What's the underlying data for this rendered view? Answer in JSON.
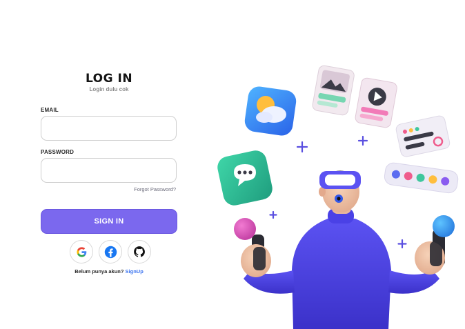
{
  "login": {
    "title": "LOG IN",
    "subtitle": "Login dulu cok",
    "email_label": "EMAIL",
    "email_value": "",
    "password_label": "PASSWORD",
    "password_value": "",
    "forgot_password": "Forgot Password?",
    "sign_in_button": "SIGN IN",
    "signup_prompt": "Belum punya akun?",
    "signup_link": "SignUp"
  },
  "social_buttons": [
    {
      "name": "Google",
      "icon": "google-icon"
    },
    {
      "name": "Facebook",
      "icon": "facebook-icon"
    },
    {
      "name": "GitHub",
      "icon": "github-icon"
    }
  ],
  "colors": {
    "primary": "#7b68ee",
    "link": "#3b74f0",
    "input_border": "#cfcfcf",
    "figure_sweater": "#4a3fe0"
  },
  "illustration": {
    "icons": [
      "weather-icon",
      "photo-card-icon",
      "video-card-icon",
      "settings-card-icon",
      "chat-bubble-icon",
      "color-palette-icon"
    ]
  }
}
